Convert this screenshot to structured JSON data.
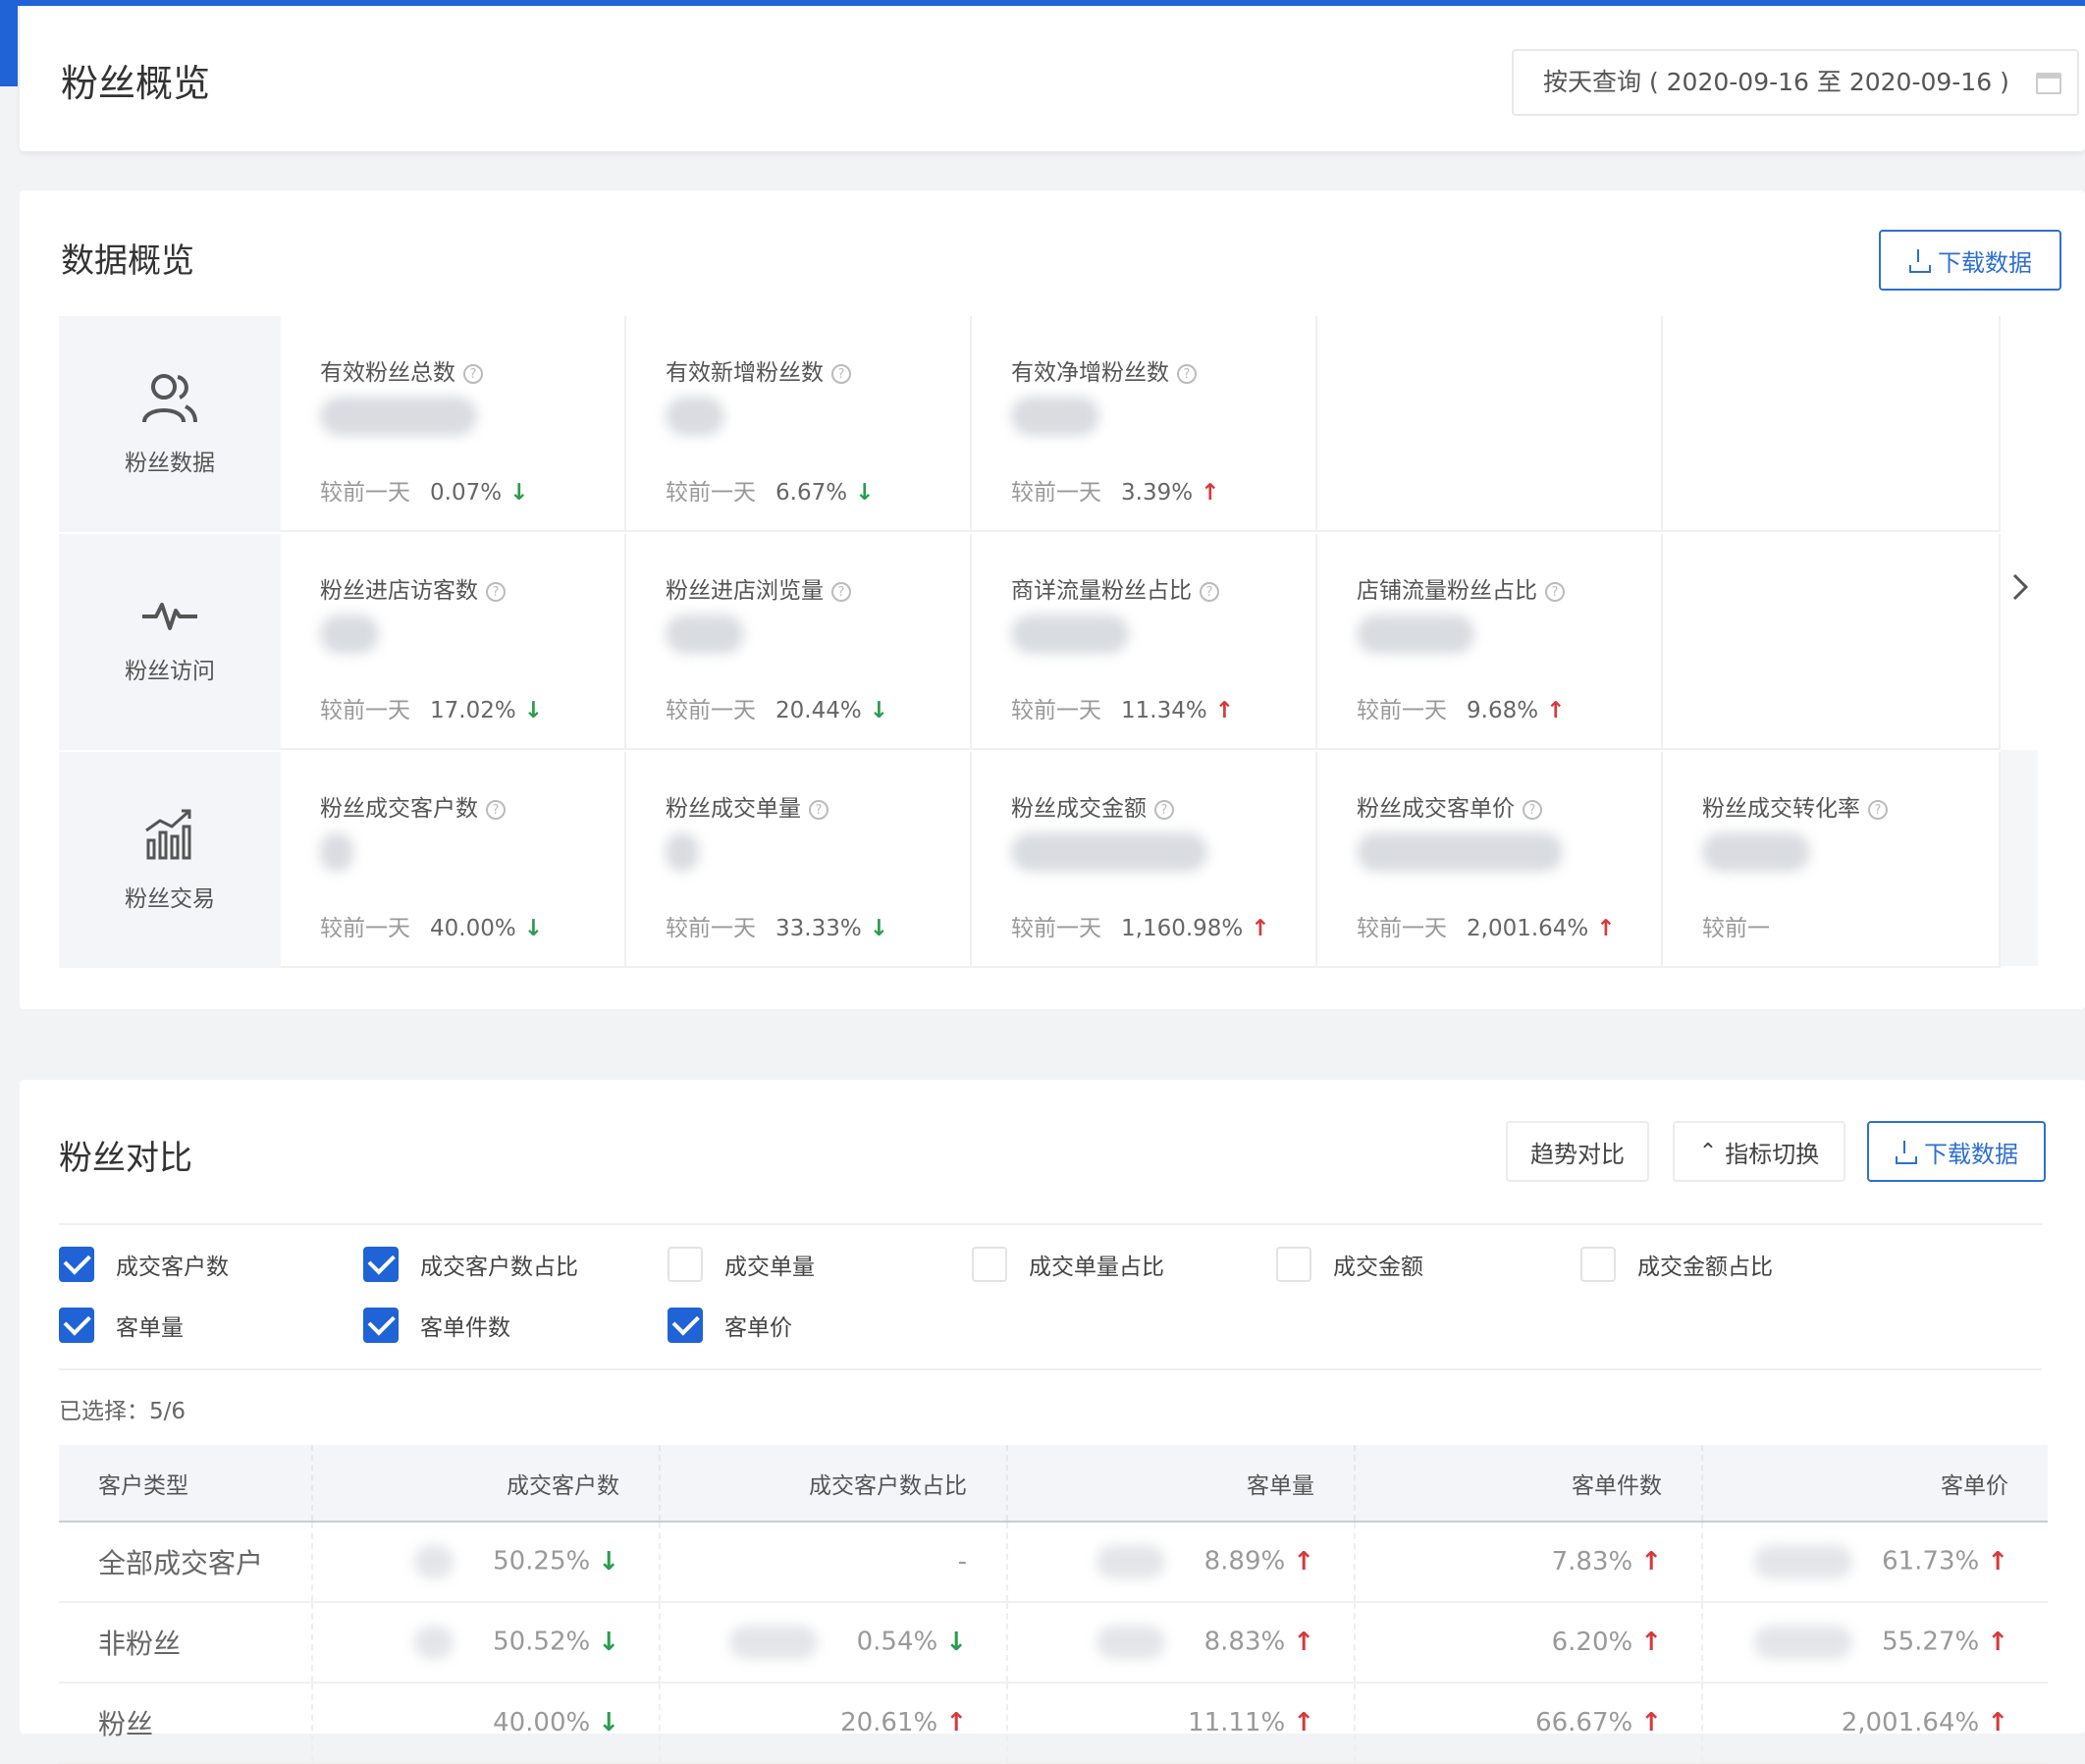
{
  "header": {
    "title": "粉丝概览",
    "date_query": "按天查询 ( 2020-09-16 至 2020-09-16 )"
  },
  "overview": {
    "title": "数据概览",
    "download_label": "下载数据",
    "rows": [
      {
        "label": "粉丝数据",
        "icon": "users-icon",
        "cells": [
          {
            "title": "有效粉丝总数",
            "compare": "较前一天",
            "value": "0.07%",
            "dir": "down"
          },
          {
            "title": "有效新增粉丝数",
            "compare": "较前一天",
            "value": "6.67%",
            "dir": "down"
          },
          {
            "title": "有效净增粉丝数",
            "compare": "较前一天",
            "value": "3.39%",
            "dir": "up"
          }
        ]
      },
      {
        "label": "粉丝访问",
        "icon": "pulse-icon",
        "cells": [
          {
            "title": "粉丝进店访客数",
            "compare": "较前一天",
            "value": "17.02%",
            "dir": "down"
          },
          {
            "title": "粉丝进店浏览量",
            "compare": "较前一天",
            "value": "20.44%",
            "dir": "down"
          },
          {
            "title": "商详流量粉丝占比",
            "compare": "较前一天",
            "value": "11.34%",
            "dir": "up"
          },
          {
            "title": "店铺流量粉丝占比",
            "compare": "较前一天",
            "value": "9.68%",
            "dir": "up"
          }
        ]
      },
      {
        "label": "粉丝交易",
        "icon": "bar-chart-icon",
        "cells": [
          {
            "title": "粉丝成交客户数",
            "compare": "较前一天",
            "value": "40.00%",
            "dir": "down"
          },
          {
            "title": "粉丝成交单量",
            "compare": "较前一天",
            "value": "33.33%",
            "dir": "down"
          },
          {
            "title": "粉丝成交金额",
            "compare": "较前一天",
            "value": "1,160.98%",
            "dir": "up"
          },
          {
            "title": "粉丝成交客单价",
            "compare": "较前一天",
            "value": "2,001.64%",
            "dir": "up"
          },
          {
            "title": "粉丝成交转化率",
            "compare": "较前一",
            "value": "",
            "dir": ""
          }
        ]
      }
    ]
  },
  "compare": {
    "title": "粉丝对比",
    "trend_label": "趋势对比",
    "switch_label": "指标切换",
    "download_label": "下载数据",
    "checkboxes_row1": [
      {
        "label": "成交客户数",
        "checked": true
      },
      {
        "label": "成交客户数占比",
        "checked": true
      },
      {
        "label": "成交单量",
        "checked": false
      },
      {
        "label": "成交单量占比",
        "checked": false
      },
      {
        "label": "成交金额",
        "checked": false
      },
      {
        "label": "成交金额占比",
        "checked": false
      }
    ],
    "checkboxes_row2": [
      {
        "label": "客单量",
        "checked": true
      },
      {
        "label": "客单件数",
        "checked": true
      },
      {
        "label": "客单价",
        "checked": true
      }
    ],
    "selected_text": "已选择：5/6",
    "columns": [
      "客户类型",
      "成交客户数",
      "成交客户数占比",
      "客单量",
      "客单件数",
      "客单价"
    ],
    "rows": [
      {
        "type": "全部成交客户",
        "cells": [
          {
            "value": "50.25%",
            "dir": "down"
          },
          {
            "value": "-",
            "dir": ""
          },
          {
            "value": "8.89%",
            "dir": "up"
          },
          {
            "value": "7.83%",
            "dir": "up"
          },
          {
            "value": "61.73%",
            "dir": "up"
          }
        ]
      },
      {
        "type": "非粉丝",
        "cells": [
          {
            "value": "50.52%",
            "dir": "down"
          },
          {
            "value": "0.54%",
            "dir": "down"
          },
          {
            "value": "8.83%",
            "dir": "up"
          },
          {
            "value": "6.20%",
            "dir": "up"
          },
          {
            "value": "55.27%",
            "dir": "up"
          }
        ]
      },
      {
        "type": "粉丝",
        "cells": [
          {
            "value": "40.00%",
            "dir": "down"
          },
          {
            "value": "20.61%",
            "dir": "up"
          },
          {
            "value": "11.11%",
            "dir": "up"
          },
          {
            "value": "66.67%",
            "dir": "up"
          },
          {
            "value": "2,001.64%",
            "dir": "up"
          }
        ]
      }
    ]
  },
  "colors": {
    "accent": "#1f63d6",
    "up": "#d63a3a",
    "down": "#2a9d4e"
  }
}
